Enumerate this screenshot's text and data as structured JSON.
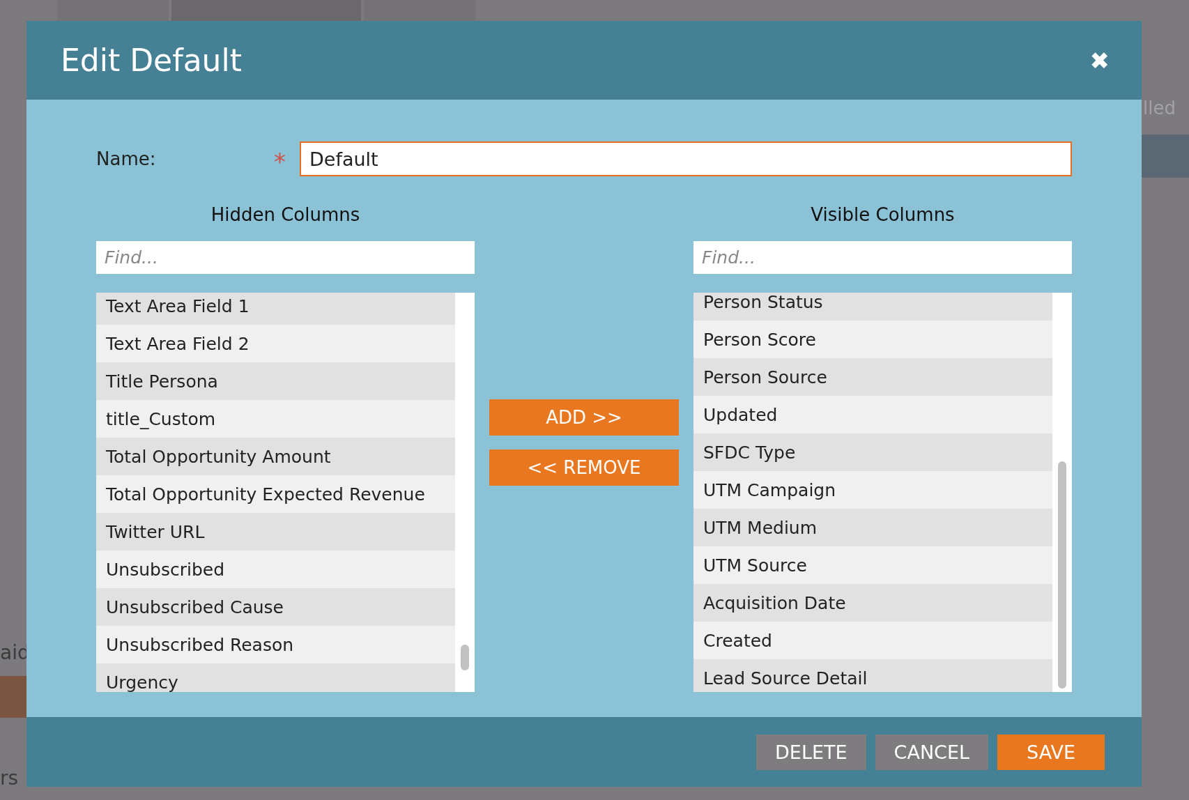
{
  "background": {
    "fragments": [
      "aid",
      "rs",
      "lled"
    ]
  },
  "dialog": {
    "title": "Edit Default",
    "close": "✖"
  },
  "name_field": {
    "label": "Name:",
    "required_mark": "*",
    "value": "Default"
  },
  "hidden_columns": {
    "heading": "Hidden Columns",
    "placeholder": "Find...",
    "items": [
      "Text Area Field 1",
      "Text Area Field 2",
      "Title Persona",
      "title_Custom",
      "Total Opportunity Amount",
      "Total Opportunity Expected Revenue",
      "Twitter URL",
      "Unsubscribed",
      "Unsubscribed Cause",
      "Unsubscribed Reason",
      "Urgency"
    ]
  },
  "transfer_buttons": [
    "ADD >>",
    "<< REMOVE"
  ],
  "visible_columns": {
    "heading": "Visible Columns",
    "placeholder": "Find...",
    "items": [
      "Person Status",
      "Person Score",
      "Person Source",
      "Updated",
      "SFDC Type",
      "UTM Campaign",
      "UTM Medium",
      "UTM Source",
      "Acquisition Date",
      "Created",
      "Lead Source Detail"
    ]
  },
  "footer_buttons": [
    {
      "label": "DELETE",
      "kind": "secondary"
    },
    {
      "label": "CANCEL",
      "kind": "secondary"
    },
    {
      "label": "SAVE",
      "kind": "primary"
    }
  ]
}
